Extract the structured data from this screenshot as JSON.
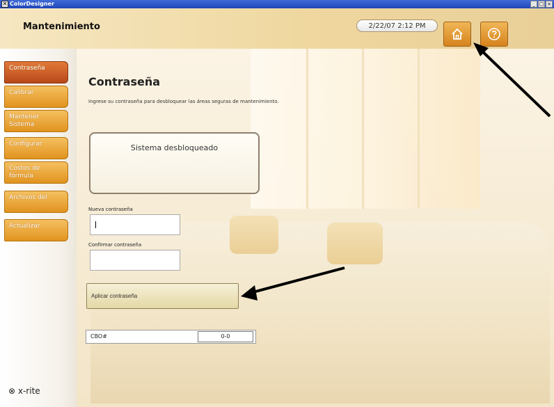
{
  "window": {
    "app_title": "ColorDesigner",
    "controls": [
      "_",
      "□",
      "×"
    ]
  },
  "header": {
    "page_title": "Mantenimiento",
    "datetime": "2/22/07 2:12 PM",
    "home_button_icon": "home-icon",
    "help_button_icon": "help-icon"
  },
  "sidebar": {
    "items": [
      {
        "label": "Contraseña",
        "active": true
      },
      {
        "label": "Calibrar",
        "active": false
      },
      {
        "label_line1": "Mantener",
        "label_line2": "Sistema",
        "active": false
      },
      {
        "label": "Configurar",
        "active": false
      },
      {
        "label_line1": "Costos de",
        "label_line2": "fórmula",
        "active": false
      },
      {
        "label": "Archivos del",
        "active": false
      },
      {
        "label": "Actualizar",
        "active": false
      }
    ],
    "logo": "x-rite"
  },
  "content": {
    "title": "Contraseña",
    "description": "Ingrese su contraseña para desbloquear las áreas seguras de mantenimiento.",
    "status_text": "Sistema desbloqueado",
    "new_password_label": "Nueva contraseña",
    "new_password_value": "",
    "confirm_password_label": "Confirmar contraseña",
    "confirm_password_value": "",
    "apply_button": "Aplicar contraseña",
    "cbo_label": "CBO#",
    "cbo_value": "0-0"
  },
  "colors": {
    "header_gold": "#efd79f",
    "nav_orange": "#e1931f",
    "nav_active": "#b8481a",
    "button_orange": "#d6831d"
  }
}
